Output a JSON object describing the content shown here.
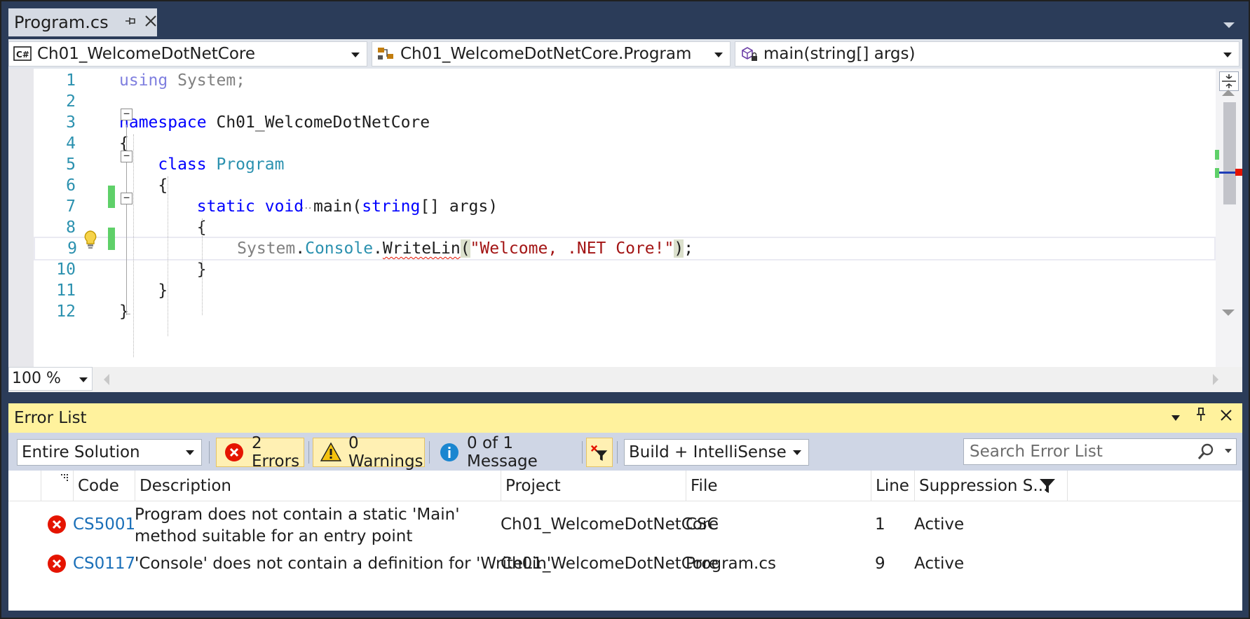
{
  "document_tab": {
    "title": "Program.cs",
    "pin_glyph": "⊣",
    "close_glyph": "✕"
  },
  "navigation_bar": {
    "project": "Ch01_WelcomeDotNetCore",
    "type": "Ch01_WelcomeDotNetCore.Program",
    "member": "main(string[] args)",
    "project_icon": "csharp-project-icon",
    "type_icon": "class-icon",
    "member_icon": "private-method-icon"
  },
  "editor": {
    "lines": [
      {
        "n": "1",
        "tokens": [
          {
            "t": "using",
            "c": "kw-dim"
          },
          {
            "t": " System;",
            "c": "dim"
          }
        ]
      },
      {
        "n": "2",
        "tokens": []
      },
      {
        "n": "3",
        "tokens": [
          {
            "t": "namespace",
            "c": "kw"
          },
          {
            "t": " Ch01_WelcomeDotNetCore",
            "c": "plain"
          }
        ]
      },
      {
        "n": "4",
        "tokens": [
          {
            "t": "{",
            "c": "plain"
          }
        ]
      },
      {
        "n": "5",
        "tokens": [
          {
            "t": "    class",
            "c": "kw"
          },
          {
            "t": " ",
            "c": "plain"
          },
          {
            "t": "Program",
            "c": "type"
          }
        ]
      },
      {
        "n": "6",
        "tokens": [
          {
            "t": "    {",
            "c": "plain"
          }
        ]
      },
      {
        "n": "7",
        "tokens": [
          {
            "t": "        static",
            "c": "kw"
          },
          {
            "t": " ",
            "c": "plain"
          },
          {
            "t": "void",
            "c": "kw"
          },
          {
            "t": " main(",
            "c": "plain"
          },
          {
            "t": "string",
            "c": "kw"
          },
          {
            "t": "[] args)",
            "c": "plain"
          }
        ]
      },
      {
        "n": "8",
        "tokens": [
          {
            "t": "        {",
            "c": "plain"
          }
        ]
      },
      {
        "n": "9",
        "tokens": [
          {
            "t": "            System",
            "c": "dim"
          },
          {
            "t": ".",
            "c": "plain"
          },
          {
            "t": "Console",
            "c": "type"
          },
          {
            "t": ".",
            "c": "plain"
          },
          {
            "t": "WriteLin",
            "c": "plain squiggle"
          },
          {
            "t": "(",
            "c": "plain brace-hl"
          },
          {
            "t": "\"Welcome, .NET Core!\"",
            "c": "str"
          },
          {
            "t": ")",
            "c": "plain brace-hl"
          },
          {
            "t": ";",
            "c": "plain"
          }
        ]
      },
      {
        "n": "10",
        "tokens": [
          {
            "t": "        }",
            "c": "plain"
          }
        ]
      },
      {
        "n": "11",
        "tokens": [
          {
            "t": "    }",
            "c": "plain"
          }
        ]
      },
      {
        "n": "12",
        "tokens": [
          {
            "t": "}",
            "c": "plain"
          }
        ]
      }
    ],
    "zoom": "100 %"
  },
  "error_list": {
    "title": "Error List",
    "scope": "Entire Solution",
    "errors_label": "2 Errors",
    "warnings_label": "0 Warnings",
    "messages_label": "0 of 1 Message",
    "source": "Build + IntelliSense",
    "search_placeholder": "Search Error List",
    "columns": [
      "Code",
      "Description",
      "Project",
      "File",
      "Line",
      "Suppression S..."
    ],
    "rows": [
      {
        "code": "CS5001",
        "description": "Program does not contain a static 'Main' method suitable for an entry point",
        "project": "Ch01_WelcomeDotNetCore",
        "file": "CSC",
        "line": "1",
        "suppression": "Active"
      },
      {
        "code": "CS0117",
        "description": "'Console' does not contain a definition for 'WriteLin'",
        "project": "Ch01_WelcomeDotNetCore",
        "file": "Program.cs",
        "line": "9",
        "suppression": "Active"
      }
    ]
  },
  "colors": {
    "chrome_background": "#2b3c59",
    "error_list_title": "#fff29d",
    "error_red": "#e51400",
    "warning_yellow": "#f4c20d",
    "info_blue": "#1a86d0",
    "change_green": "#5fd069",
    "line_number": "#2b91af"
  }
}
